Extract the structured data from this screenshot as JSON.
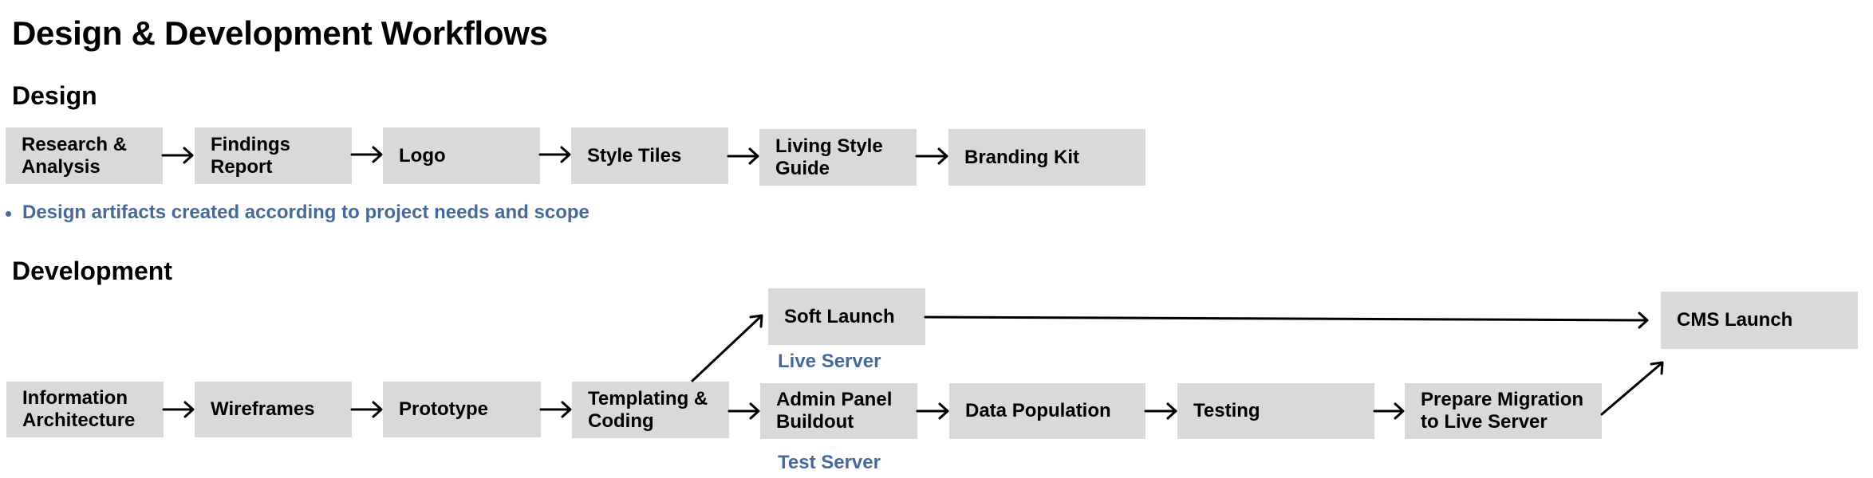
{
  "page": {
    "title": "Design & Development Workflows"
  },
  "design": {
    "heading": "Design",
    "steps": [
      "Research &\nAnalysis",
      "Findings\nReport",
      "Logo",
      "Style Tiles",
      "Living Style\nGuide",
      "Branding Kit"
    ],
    "note": "Design artifacts created according to project needs and scope"
  },
  "development": {
    "heading": "Development",
    "steps": {
      "information_architecture": "Information\nArchitecture",
      "wireframes": "Wireframes",
      "prototype": "Prototype",
      "templating_coding": "Templating &\nCoding",
      "soft_launch": "Soft Launch",
      "admin_panel_buildout": "Admin  Panel\nBuildout",
      "data_population": "Data Population",
      "testing": "Testing",
      "prepare_migration": "Prepare Migration\nto Live Server",
      "cms_launch": "CMS Launch"
    },
    "labels": {
      "live_server": "Live Server",
      "test_server": "Test Server"
    }
  },
  "colors": {
    "node_fill": "#d9d9d9",
    "accent_text": "#46699a",
    "text": "#000000"
  }
}
